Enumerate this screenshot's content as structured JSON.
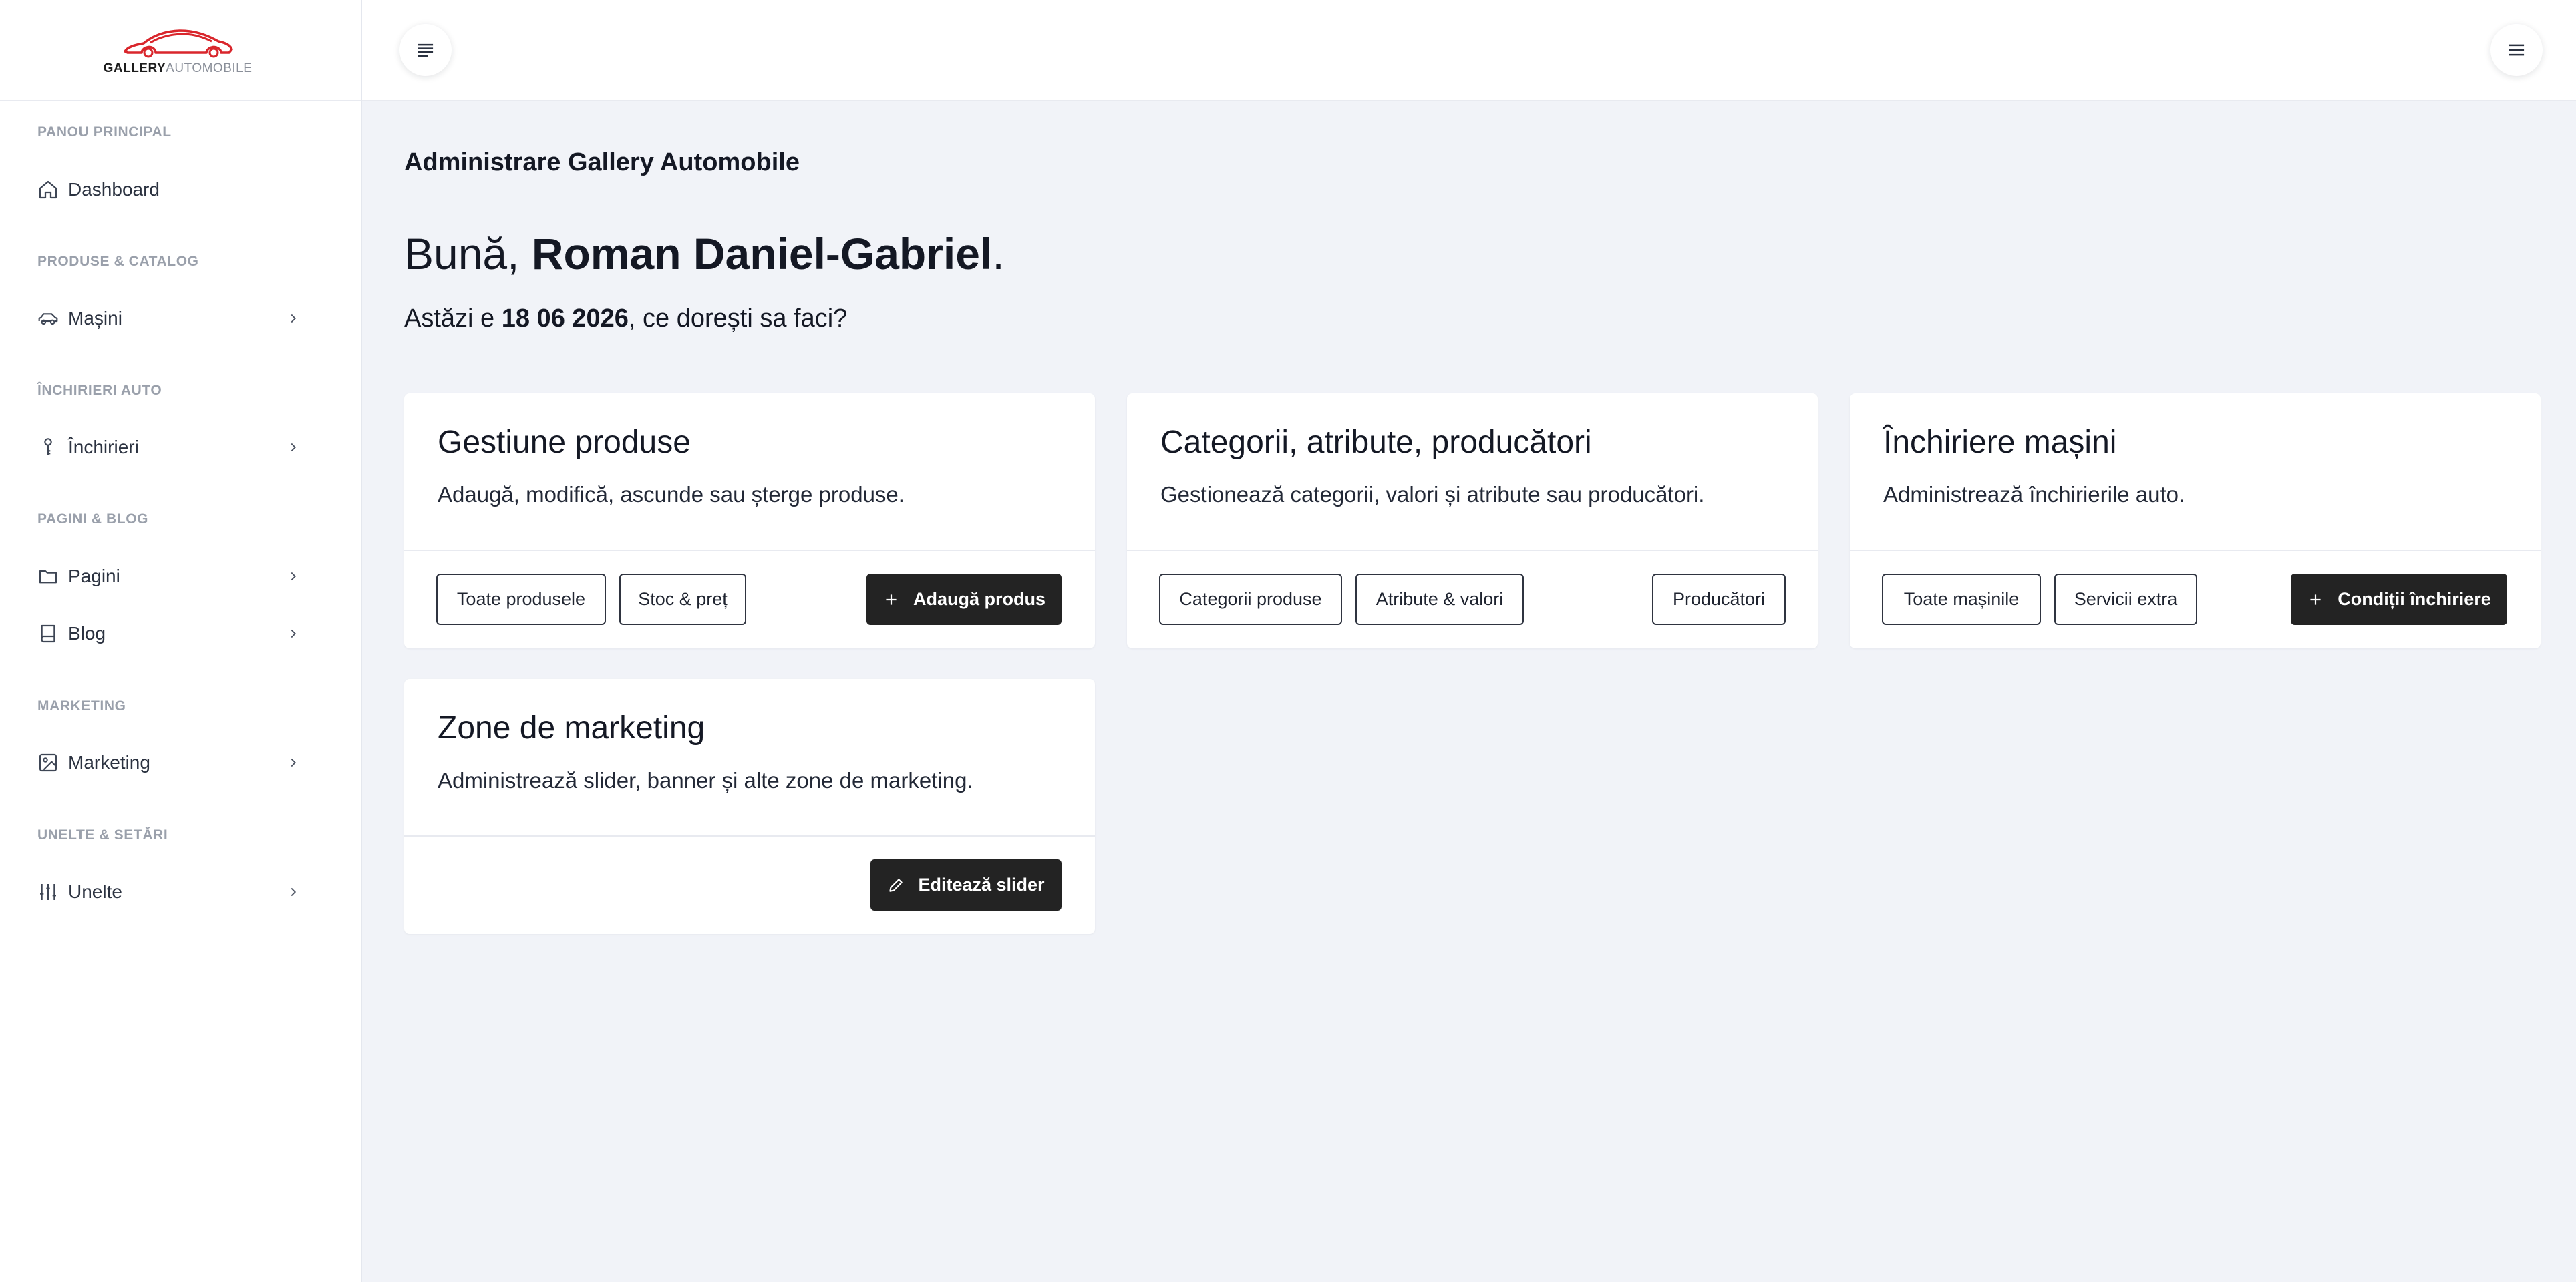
{
  "logo": {
    "bold": "GALLERY",
    "light": "AUTOMOBILE",
    "accent_color": "#d9262c"
  },
  "sidebar": {
    "sections": [
      {
        "label": "PANOU PRINCIPAL"
      },
      {
        "label": "PRODUSE & CATALOG"
      },
      {
        "label": "ÎNCHIRIERI AUTO"
      },
      {
        "label": "PAGINI & BLOG"
      },
      {
        "label": "MARKETING"
      },
      {
        "label": "UNELTE & SETĂRI"
      }
    ],
    "items": [
      {
        "label": "Dashboard",
        "icon": "home-icon"
      },
      {
        "label": "Mașini",
        "icon": "car-icon"
      },
      {
        "label": "Închirieri",
        "icon": "key-icon"
      },
      {
        "label": "Pagini",
        "icon": "folder-icon"
      },
      {
        "label": "Blog",
        "icon": "book-icon"
      },
      {
        "label": "Marketing",
        "icon": "image-icon"
      },
      {
        "label": "Unelte",
        "icon": "sliders-icon"
      }
    ]
  },
  "topbar": {
    "left_icon": "align-left-icon",
    "right_icon": "hamburger-menu-icon"
  },
  "main": {
    "admin_title": "Administrare Gallery Automobile",
    "greeting_prefix": "Bună, ",
    "user_name": "Roman Daniel-Gabriel",
    "greeting_suffix": ".",
    "date_prefix": "Astăzi e ",
    "date": "18 06 2026",
    "date_suffix": ", ce dorești sa faci?"
  },
  "cards": [
    {
      "title": "Gestiune produse",
      "description": "Adaugă, modifică, ascunde sau șterge produse.",
      "buttons": [
        {
          "label": "Toate produsele"
        },
        {
          "label": "Stoc & preț"
        },
        {
          "label": "Adaugă produs",
          "icon": "plus-icon"
        }
      ]
    },
    {
      "title": "Categorii, atribute, producători",
      "description": "Gestionează categorii, valori și atribute sau producători.",
      "buttons": [
        {
          "label": "Categorii produse"
        },
        {
          "label": "Atribute & valori"
        },
        {
          "label": "Producători"
        }
      ]
    },
    {
      "title": "Închiriere mașini",
      "description": "Administrează închirierile auto.",
      "buttons": [
        {
          "label": "Toate mașinile"
        },
        {
          "label": "Servicii extra"
        },
        {
          "label": "Condiții închiriere",
          "icon": "plus-icon"
        }
      ]
    },
    {
      "title": "Zone de marketing",
      "description": "Administrează slider, banner și alte zone de marketing.",
      "buttons": [
        {
          "label": "Editează slider",
          "icon": "pencil-icon"
        }
      ]
    }
  ]
}
